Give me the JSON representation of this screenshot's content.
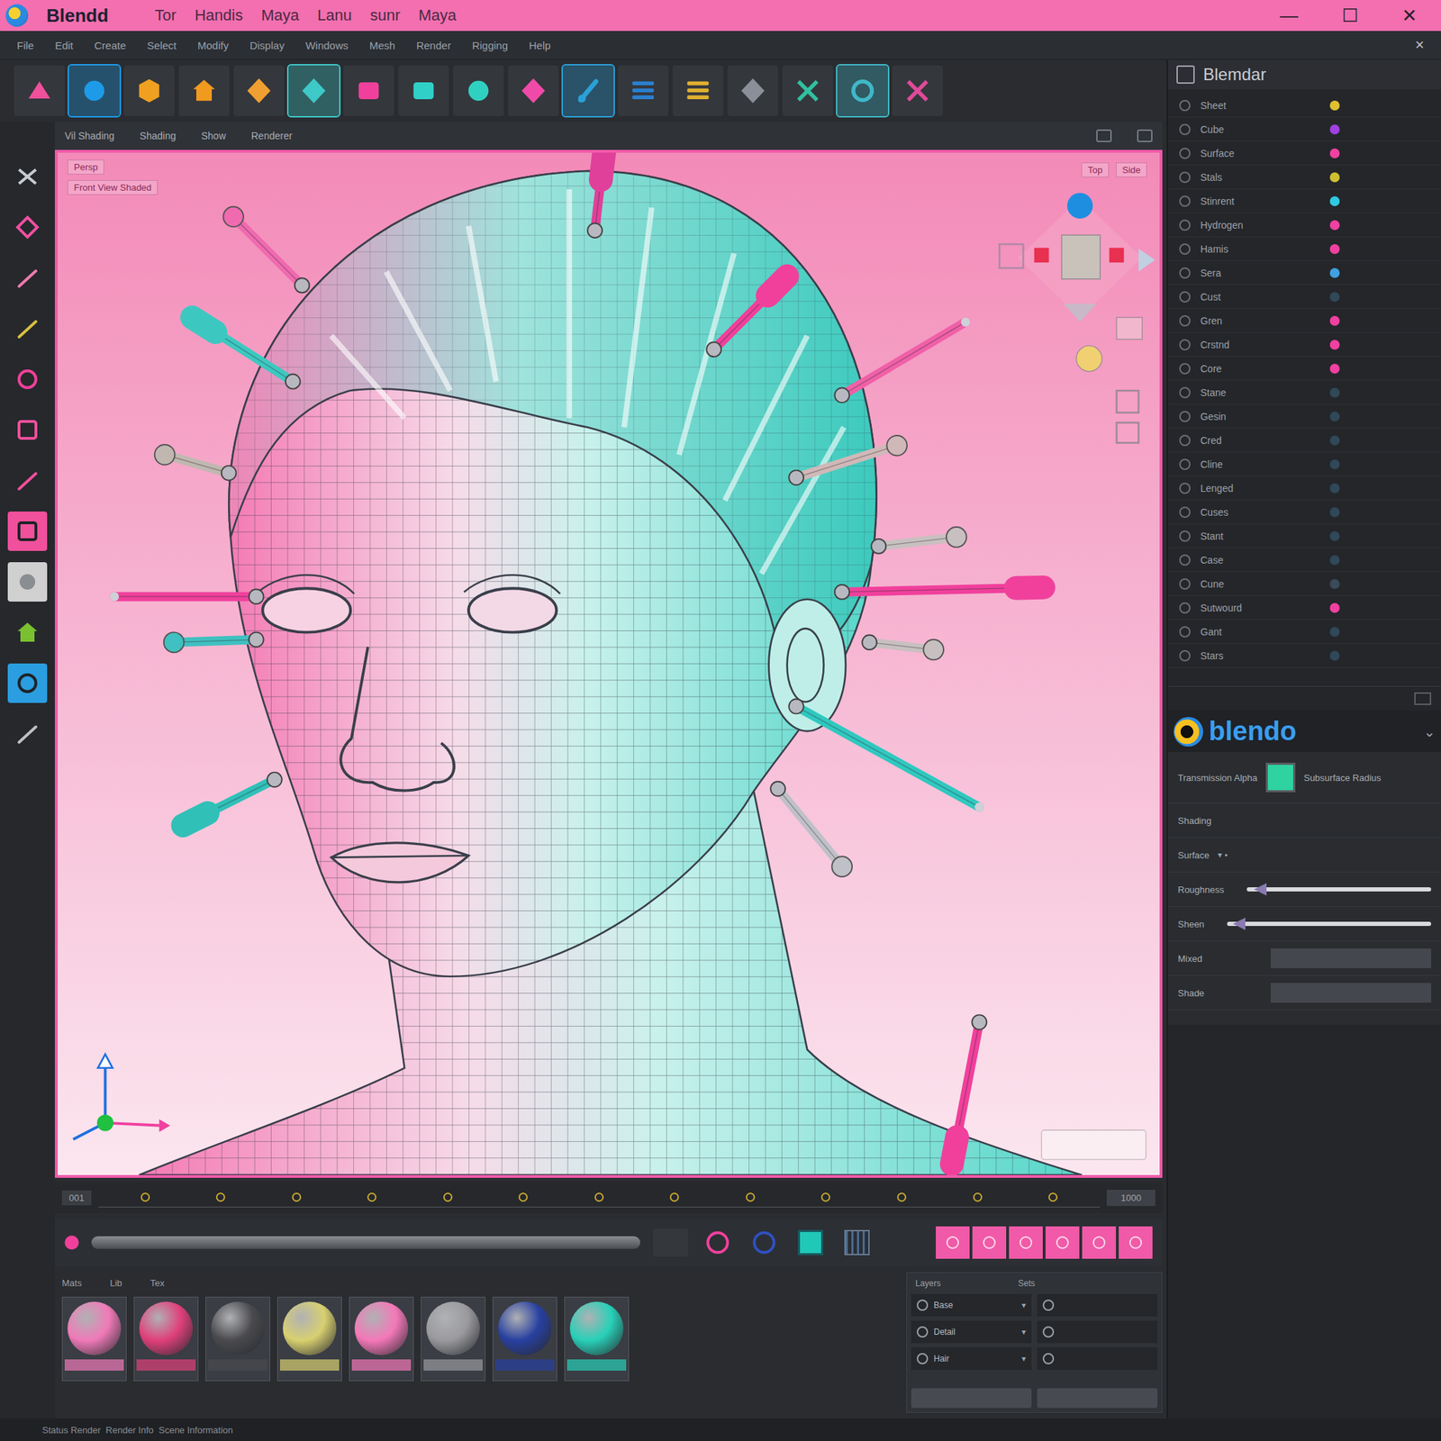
{
  "window": {
    "title": "Blendd",
    "tabs": [
      "Tor",
      "Handis",
      "Maya",
      "Lanu",
      "sunr",
      "Maya"
    ],
    "controls": [
      "—",
      "☐",
      "✕"
    ]
  },
  "menubar": {
    "items": [
      "File",
      "Edit",
      "Create",
      "Select",
      "Modify",
      "Display",
      "Windows",
      "Mesh",
      "Render",
      "Rigging",
      "Help"
    ],
    "close": "×"
  },
  "toolbar": {
    "tools": [
      {
        "color": "#f0509c",
        "selected": false
      },
      {
        "color": "#1e9be8",
        "selected": true
      },
      {
        "color": "#f0a020",
        "selected": false
      },
      {
        "color": "#f09a20",
        "selected": false
      },
      {
        "color": "#f0a030",
        "selected": false
      },
      {
        "color": "#3ec8c8",
        "selected": true
      },
      {
        "color": "#f0409c",
        "selected": false
      },
      {
        "color": "#30d0c8",
        "selected": false
      },
      {
        "color": "#30d0c0",
        "selected": false
      },
      {
        "color": "#f04aa8",
        "selected": false
      },
      {
        "color": "#2aa0d8",
        "selected": true
      },
      {
        "color": "#2a80d0",
        "selected": false
      },
      {
        "color": "#e0b030",
        "selected": false
      },
      {
        "color": "#8a8f98",
        "selected": false
      },
      {
        "color": "#30c0a0",
        "selected": false
      },
      {
        "color": "#40b8c8",
        "selected": true
      },
      {
        "color": "#e04a9a",
        "selected": false
      }
    ]
  },
  "left_tools": [
    {
      "color": "#c8ccd0",
      "selected": false
    },
    {
      "color": "#f050a0",
      "selected": false
    },
    {
      "color": "#f07ab0",
      "selected": false
    },
    {
      "color": "#d8c040",
      "selected": false
    },
    {
      "color": "#f0409a",
      "selected": false
    },
    {
      "color": "#f0509c",
      "selected": false
    },
    {
      "color": "#f0509c",
      "selected": false
    },
    {
      "color": "#f0509c",
      "selected": true
    },
    {
      "color": "#d0d0d0",
      "selected": true
    },
    {
      "color": "#7ac030",
      "selected": false
    },
    {
      "color": "#2a9ee0",
      "selected": true
    },
    {
      "color": "#c0c0c0",
      "selected": false
    }
  ],
  "viewport": {
    "header": [
      "Vil Shading",
      "Shading",
      "Show",
      "Renderer"
    ],
    "labels_left": [
      "Persp",
      "Front View Shaded"
    ],
    "labels_right": [
      "Top",
      "Side"
    ]
  },
  "outliner": {
    "title": "Blemdar",
    "items": [
      {
        "name": "Sheet",
        "color": "#e0c030"
      },
      {
        "name": "Cube",
        "color": "#a040e0"
      },
      {
        "name": "Surface",
        "color": "#f040a0"
      },
      {
        "name": "Stals",
        "color": "#d0c030"
      },
      {
        "name": "Stinrent",
        "color": "#30c8e0"
      },
      {
        "name": "Hydrogen",
        "color": "#f040a0"
      },
      {
        "name": "Hamis",
        "color": "#f040a0"
      },
      {
        "name": "Sera",
        "color": "#40a0e0"
      },
      {
        "name": "Cust",
        "color": "#304858"
      },
      {
        "name": "Gren",
        "color": "#f040a0"
      },
      {
        "name": "Crstnd",
        "color": "#f040a0"
      },
      {
        "name": "Core",
        "color": "#f040a0"
      },
      {
        "name": "Stane",
        "color": "#304858"
      },
      {
        "name": "Gesin",
        "color": "#304858"
      },
      {
        "name": "Cred",
        "color": "#304858"
      },
      {
        "name": "Cline",
        "color": "#304858"
      },
      {
        "name": "Lenged",
        "color": "#304858"
      },
      {
        "name": "Cuses",
        "color": "#304858"
      },
      {
        "name": "Stant",
        "color": "#304858"
      },
      {
        "name": "Case",
        "color": "#304858"
      },
      {
        "name": "Cune",
        "color": "#3a4a5a"
      },
      {
        "name": "Sutwourd",
        "color": "#f040a0"
      },
      {
        "name": "Gant",
        "color": "#304858"
      },
      {
        "name": "Stars",
        "color": "#304858"
      }
    ]
  },
  "properties": {
    "logo": "blendo",
    "rows": [
      {
        "kind": "swatch",
        "label": "Transmission Alpha",
        "value": "Subsurface Radius",
        "color": "#2ed3a0"
      },
      {
        "kind": "header",
        "label": "Shading"
      },
      {
        "kind": "dropdown",
        "label": "Surface"
      },
      {
        "kind": "slider",
        "label": "Roughness",
        "level": 0.04
      },
      {
        "kind": "slider",
        "label": "Sheen",
        "level": 0.03
      },
      {
        "kind": "field",
        "label": "Mixed"
      },
      {
        "kind": "field",
        "label": "Shade"
      }
    ]
  },
  "timeline": {
    "start": "001",
    "end": "1000"
  },
  "materials": {
    "tabs": [
      "Mats",
      "Lib",
      "Tex"
    ],
    "swatches": [
      {
        "color": "#f07ab8"
      },
      {
        "color": "#e0407a"
      },
      {
        "color": "#4a4a4e"
      },
      {
        "color": "#d8d070"
      },
      {
        "color": "#f478b8"
      },
      {
        "color": "#9a9a9e"
      },
      {
        "color": "#2840a0"
      },
      {
        "color": "#28d0b8"
      }
    ]
  },
  "layers": {
    "tabs": [
      "Layers",
      "Sets"
    ],
    "rows": [
      {
        "label": "Base"
      },
      {
        "label": "Detail"
      },
      {
        "label": "Hair"
      }
    ]
  },
  "status_bar": "Status Render  Render Info  Scene Information"
}
